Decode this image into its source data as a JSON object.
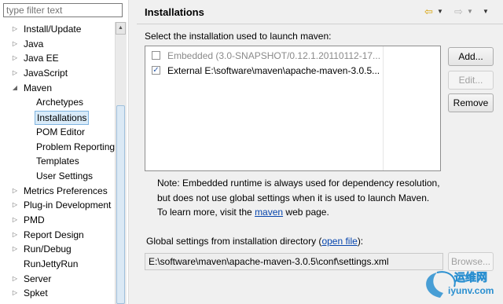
{
  "filter": {
    "placeholder": "type filter text"
  },
  "tree": {
    "items": [
      {
        "label": "Install/Update",
        "expander": "▷",
        "level": 0
      },
      {
        "label": "Java",
        "expander": "▷",
        "level": 0
      },
      {
        "label": "Java EE",
        "expander": "▷",
        "level": 0
      },
      {
        "label": "JavaScript",
        "expander": "▷",
        "level": 0
      },
      {
        "label": "Maven",
        "expander": "◢",
        "level": 0
      },
      {
        "label": "Archetypes",
        "expander": "",
        "level": 1
      },
      {
        "label": "Installations",
        "expander": "",
        "level": 1,
        "selected": true
      },
      {
        "label": "POM Editor",
        "expander": "",
        "level": 1
      },
      {
        "label": "Problem Reporting",
        "expander": "",
        "level": 1
      },
      {
        "label": "Templates",
        "expander": "",
        "level": 1
      },
      {
        "label": "User Settings",
        "expander": "",
        "level": 1
      },
      {
        "label": "Metrics Preferences",
        "expander": "▷",
        "level": 0
      },
      {
        "label": "Plug-in Development",
        "expander": "▷",
        "level": 0
      },
      {
        "label": "PMD",
        "expander": "▷",
        "level": 0
      },
      {
        "label": "Report Design",
        "expander": "▷",
        "level": 0
      },
      {
        "label": "Run/Debug",
        "expander": "▷",
        "level": 0
      },
      {
        "label": "RunJettyRun",
        "expander": "",
        "level": 0
      },
      {
        "label": "Server",
        "expander": "▷",
        "level": 0
      },
      {
        "label": "Spket",
        "expander": "▷",
        "level": 0
      }
    ]
  },
  "panel": {
    "title": "Installations",
    "nav": {
      "back": "⇦",
      "forward": "⇨",
      "dropdown": "▼"
    },
    "select_label": "Select the installation used to launch maven:",
    "installations": [
      {
        "label": "Embedded (3.0-SNAPSHOT/0.12.1.20110112-17...",
        "checked": false,
        "mark": "",
        "enabled": false
      },
      {
        "label": "External E:\\software\\maven\\apache-maven-3.0.5...",
        "checked": true,
        "mark": "✓",
        "enabled": true
      }
    ],
    "buttons": {
      "add": "Add...",
      "edit": "Edit...",
      "remove": "Remove",
      "browse": "Browse..."
    },
    "note": {
      "text": "Note: Embedded runtime is always used for dependency resolution, but does not use global settings when it is used to launch Maven. To learn more, visit the ",
      "link": "maven",
      "suffix": " web page."
    },
    "global_settings": {
      "label_prefix": "Global settings from installation directory (",
      "link": "open file",
      "label_suffix": "):",
      "value": "E:\\software\\maven\\apache-maven-3.0.5\\conf\\settings.xml"
    }
  },
  "watermark": {
    "cn": "运维网",
    "url": "iyunv.com"
  },
  "colors": {
    "selection_bg": "#d9ebf9",
    "selection_border": "#7fb4e0",
    "link": "#0645ad",
    "back_arrow": "#d8a000"
  }
}
